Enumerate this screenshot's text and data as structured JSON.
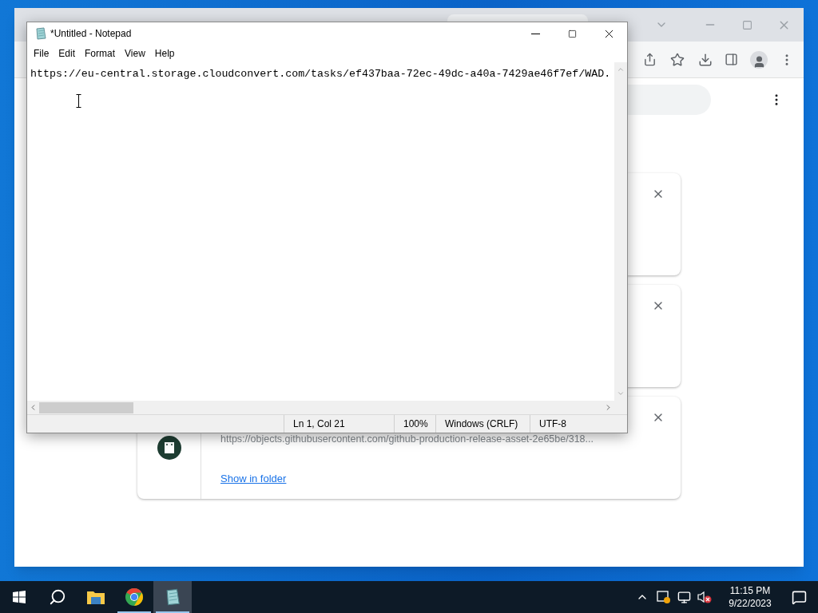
{
  "browser": {
    "downloads": [
      {
        "kind": "hidden"
      },
      {
        "kind": "hidden"
      },
      {
        "kind": "file",
        "url": "https://objects.githubusercontent.com/github-production-release-asset-2e65be/318...",
        "action": "Show in folder"
      }
    ]
  },
  "notepad": {
    "title": "*Untitled - Notepad",
    "menu": [
      "File",
      "Edit",
      "Format",
      "View",
      "Help"
    ],
    "text": "https://eu-central.storage.cloudconvert.com/tasks/ef437baa-72ec-49dc-a40a-7429ae46f7ef/WAD.",
    "status": [
      "Ln 1, Col 21",
      "100%",
      "Windows (CRLF)",
      "UTF-8"
    ]
  },
  "taskbar": {
    "apps": [
      {
        "kind": "explorer",
        "running": false,
        "selected": false
      },
      {
        "kind": "chrome",
        "running": true,
        "selected": false
      },
      {
        "kind": "notepad",
        "running": true,
        "selected": true
      }
    ],
    "clock": {
      "time": "11:15 PM",
      "date": "9/22/2023"
    }
  }
}
